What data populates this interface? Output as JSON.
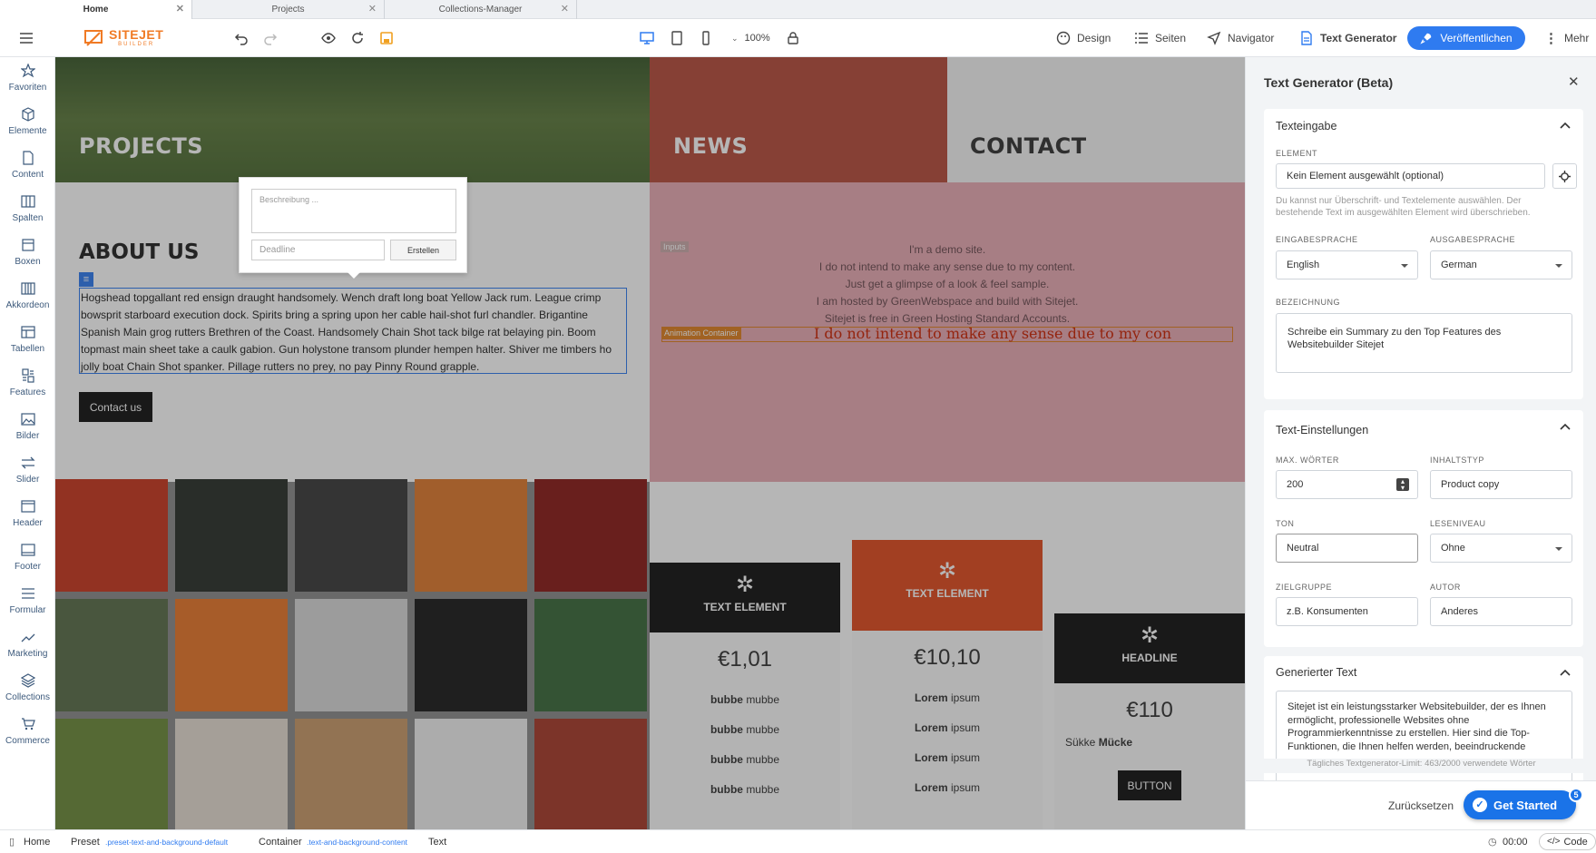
{
  "tabs": [
    {
      "label": "Home"
    },
    {
      "label": "Projects"
    },
    {
      "label": "Collections-Manager"
    }
  ],
  "toolbar": {
    "logo_text": "SITEJET",
    "logo_sub": "BUILDER",
    "zoom": "100%",
    "design": "Design",
    "pages": "Seiten",
    "navigator": "Navigator",
    "textgen": "Text Generator",
    "publish": "Veröffentlichen",
    "more": "Mehr"
  },
  "sidebar": {
    "items": [
      {
        "label": "Favoriten"
      },
      {
        "label": "Elemente"
      },
      {
        "label": "Content"
      },
      {
        "label": "Spalten"
      },
      {
        "label": "Boxen"
      },
      {
        "label": "Akkordeon"
      },
      {
        "label": "Tabellen"
      },
      {
        "label": "Features"
      },
      {
        "label": "Bilder"
      },
      {
        "label": "Slider"
      },
      {
        "label": "Header"
      },
      {
        "label": "Footer"
      },
      {
        "label": "Formular"
      },
      {
        "label": "Marketing"
      },
      {
        "label": "Collections"
      },
      {
        "label": "Commerce"
      }
    ]
  },
  "canvas": {
    "nav": {
      "projects": "PROJECTS",
      "news": "NEWS",
      "contact": "CONTACT"
    },
    "popup": {
      "description_placeholder": "Beschreibung ...",
      "deadline_placeholder": "Deadline",
      "create": "Erstellen"
    },
    "about": {
      "title": "ABOUT US",
      "text": "Hogshead topgallant red ensign draught handsomely. Wench draft long boat Yellow Jack rum. League crimp bowsprit starboard execution dock. Spirits bring a spring upon her cable hail-shot furl chandler. Brigantine Spanish Main grog rutters Brethren of the Coast. Handsomely Chain Shot tack bilge rat belaying pin. Boom topmast main sheet take a caulk gabion. Gun holystone transom plunder hempen halter. Shiver me timbers ho jolly boat Chain Shot spanker. Pillage rutters no prey, no pay Pinny Round grapple.",
      "contact_button": "Contact us"
    },
    "demo": {
      "inputs_label": "Inputs",
      "lines": [
        "I'm a demo site.",
        "I do not intend to make any sense due to my content.",
        "Just get a glimpse of a look & feel sample.",
        "I am hosted by GreenWebspace and build with Sitejet.",
        "Sitejet is free in Green Hosting Standard Accounts."
      ],
      "anim_label": "Animation Container",
      "anim_text": "I do not intend to make any sense due to my con"
    },
    "pricing": [
      {
        "title": "TEXT ELEMENT",
        "price": "€1,01",
        "rows": [
          [
            "bubbe",
            "mubbe"
          ],
          [
            "bubbe",
            "mubbe"
          ],
          [
            "bubbe",
            "mubbe"
          ],
          [
            "bubbe",
            "mubbe"
          ]
        ]
      },
      {
        "title": "TEXT ELEMENT",
        "price": "€10,10",
        "rows": [
          [
            "Lorem",
            "ipsum"
          ],
          [
            "Lorem",
            "ipsum"
          ],
          [
            "Lorem",
            "ipsum"
          ],
          [
            "Lorem",
            "ipsum"
          ]
        ]
      },
      {
        "title": "HEADLINE",
        "price": "€110",
        "rows": [
          [
            "Sükke",
            "Mücke"
          ]
        ],
        "button": "BUTTON"
      }
    ]
  },
  "panel": {
    "title": "Text Generator (Beta)",
    "input_section": {
      "title": "Texteingabe",
      "element_label": "ELEMENT",
      "element_value": "Kein Element ausgewählt (optional)",
      "element_hint": "Du kannst nur Überschrift- und Textelemente auswählen. Der bestehende Text im ausgewählten Element wird überschrieben.",
      "input_lang_label": "EINGABESPRACHE",
      "input_lang": "English",
      "output_lang_label": "AUSGABESPRACHE",
      "output_lang": "German",
      "desc_label": "BEZEICHNUNG",
      "desc_value": "Schreibe ein Summary zu den Top Features des Websitebuilder Sitejet"
    },
    "settings_section": {
      "title": "Text-Einstellungen",
      "max_words_label": "MAX. WÖRTER",
      "max_words": "200",
      "content_type_label": "INHALTSTYP",
      "content_type": "Product copy",
      "tone_label": "TON",
      "tone": "Neutral",
      "reading_label": "LESENIVEAU",
      "reading": "Ohne",
      "target_label": "ZIELGRUPPE",
      "target_placeholder": "z.B. Konsumenten",
      "author_label": "AUTOR",
      "author": "Anderes"
    },
    "output_section": {
      "title": "Generierter Text",
      "text": "Sitejet ist ein leistungsstarker Websitebuilder, der es Ihnen ermöglicht, professionelle Websites ohne Programmierkenntnisse zu erstellen. Hier sind die Top-Funktionen, die Ihnen helfen werden, beeindruckende"
    },
    "limit": "Tägliches Textgenerator-Limit: 463/2000 verwendete Wörter",
    "reset": "Zurücksetzen",
    "get_started": "Get Started",
    "badge": "5"
  },
  "bottombar": {
    "home": "Home",
    "preset": "Preset",
    "preset_class": ".preset-text-and-background-default",
    "container": "Container",
    "container_class": ".text-and-background-content",
    "text": "Text",
    "time": "00:00",
    "code": "Code"
  }
}
